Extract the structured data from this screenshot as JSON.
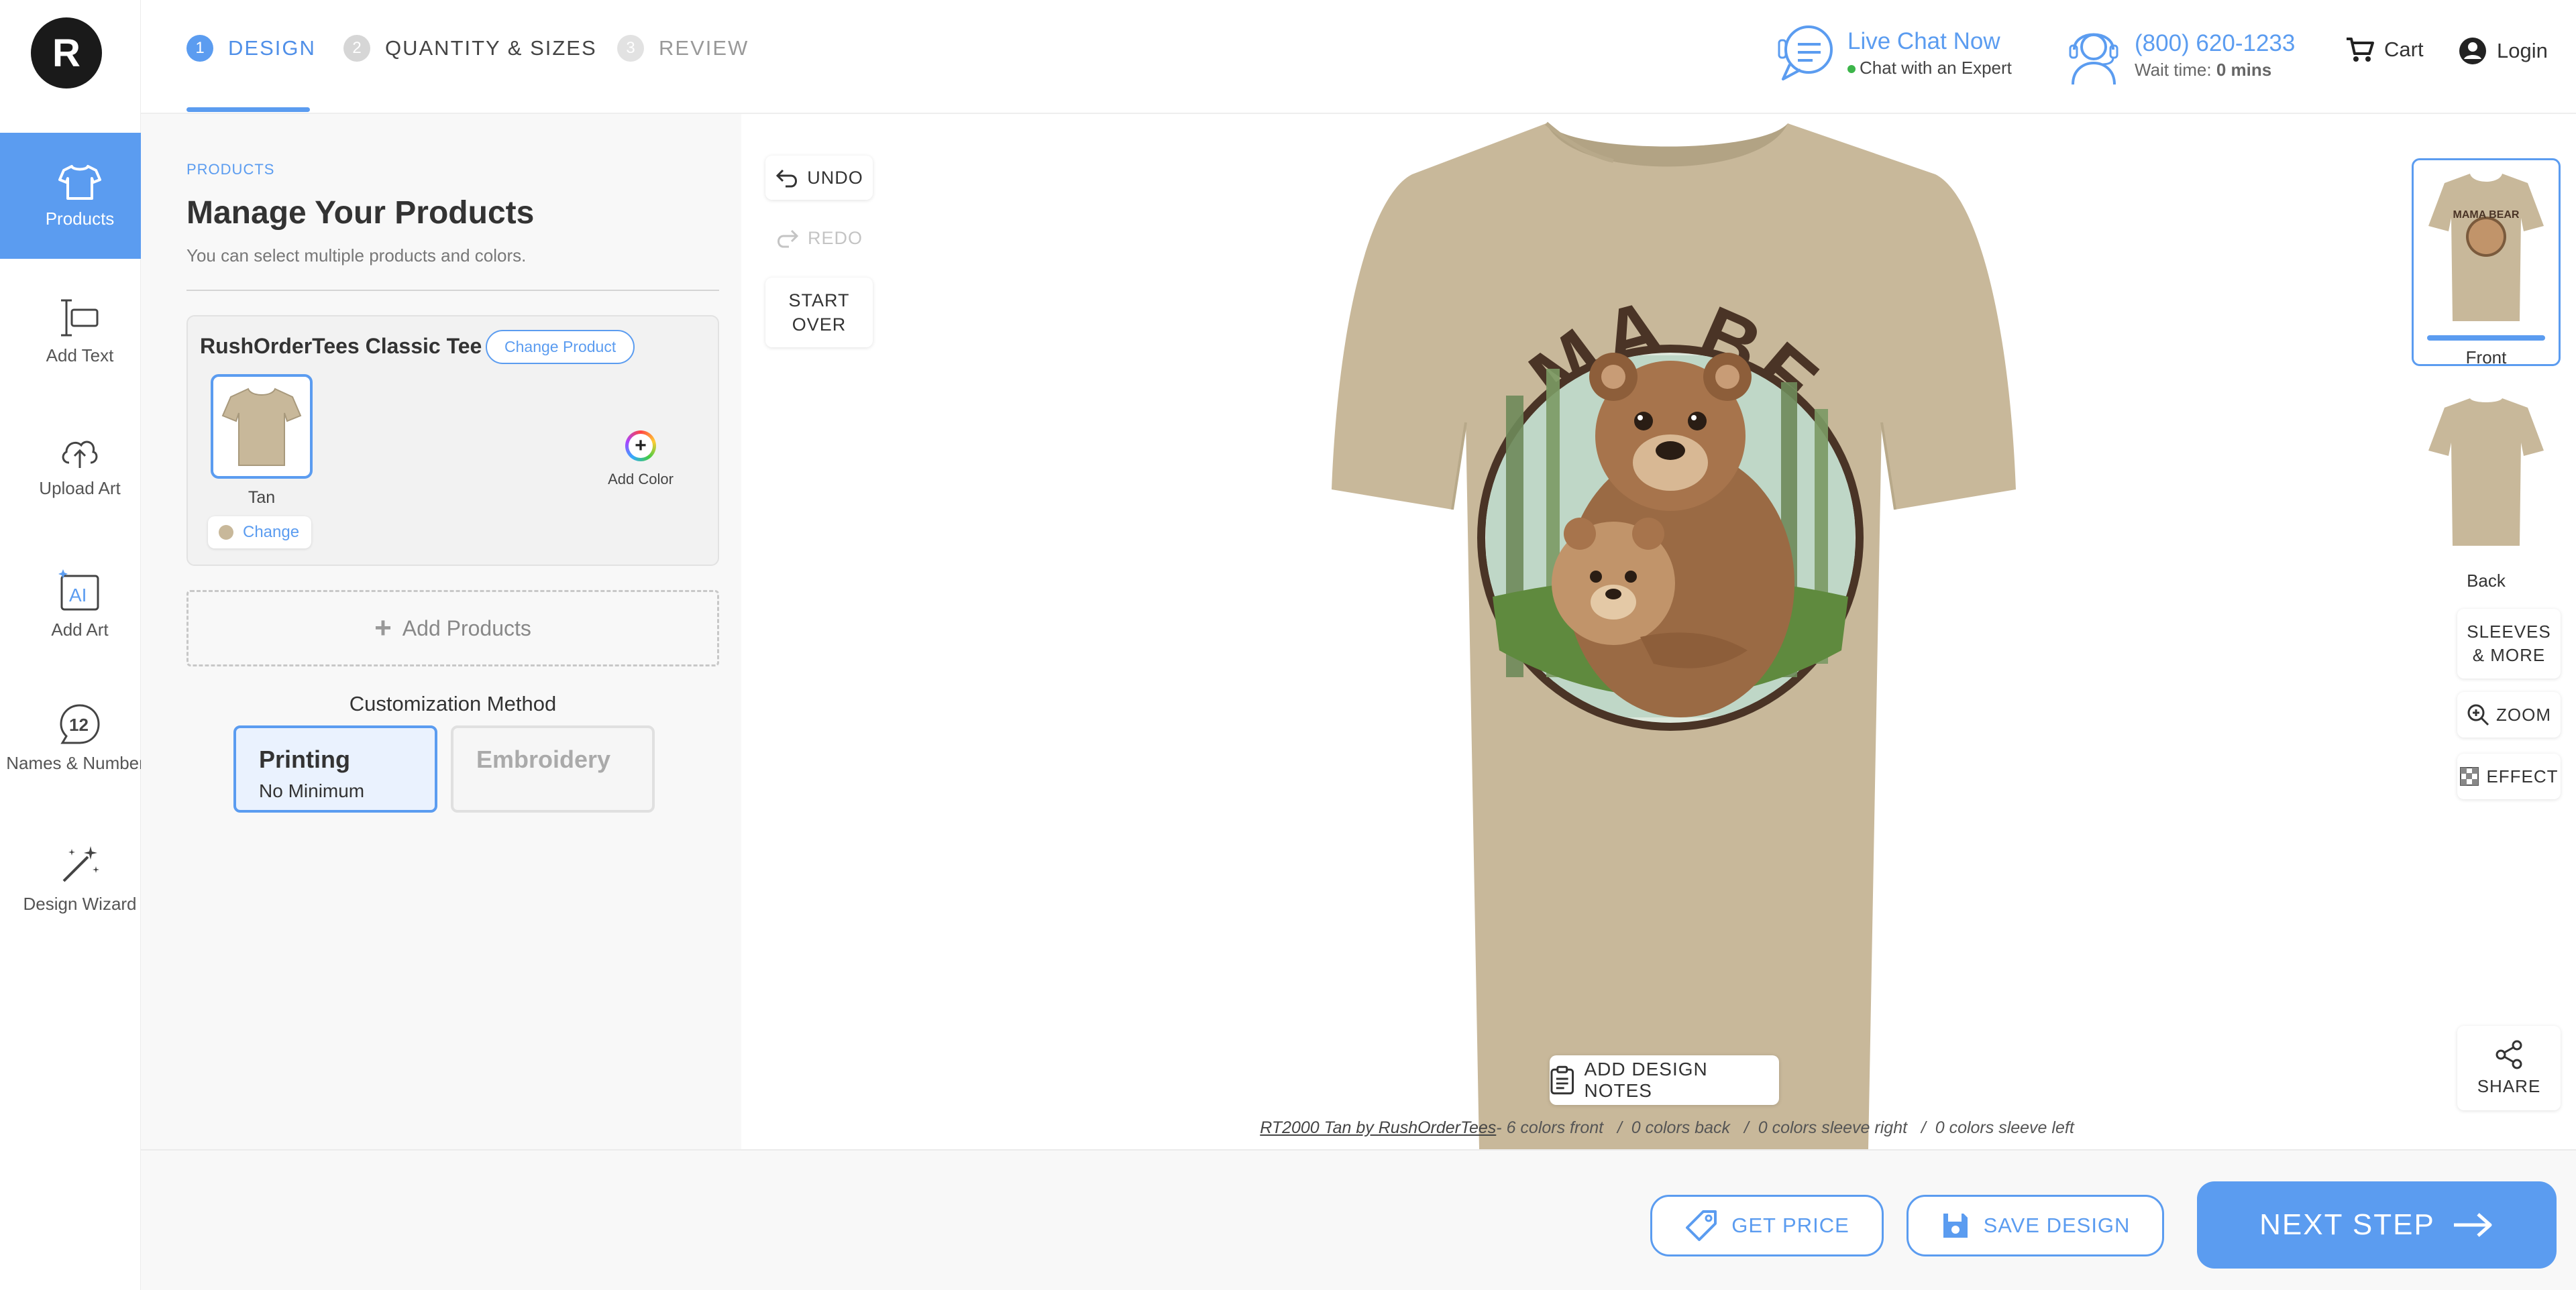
{
  "brand": {
    "logo_letter": "R"
  },
  "rail": {
    "items": [
      {
        "label": "Products",
        "icon": "tshirt-icon"
      },
      {
        "label": "Add Text",
        "icon": "text-icon"
      },
      {
        "label": "Upload Art",
        "icon": "upload-cloud-icon"
      },
      {
        "label": "Add Art",
        "icon": "ai-art-icon"
      },
      {
        "label": "Names & Numbers",
        "icon": "numbers-icon"
      },
      {
        "label": "Design Wizard",
        "icon": "magic-wand-icon"
      }
    ]
  },
  "steps": [
    {
      "num": "1",
      "label": "DESIGN"
    },
    {
      "num": "2",
      "label": "QUANTITY & SIZES"
    },
    {
      "num": "3",
      "label": "REVIEW"
    }
  ],
  "header": {
    "chat_title": "Live Chat Now",
    "chat_sub": "Chat with an Expert",
    "phone": "(800) 620-1233",
    "wait_label": "Wait time:",
    "wait_value": "0 mins",
    "cart": "Cart",
    "login": "Login"
  },
  "panel": {
    "crumb": "PRODUCTS",
    "title": "Manage Your Products",
    "subtitle": "You can select multiple products and colors.",
    "product_name": "RushOrderTees Classic Tee",
    "change_product": "Change Product",
    "color_name": "Tan",
    "change_color": "Change",
    "add_color": "Add Color",
    "add_products": "Add Products",
    "customization_label": "Customization Method",
    "methods": [
      {
        "name": "Printing",
        "note": "No Minimum"
      },
      {
        "name": "Embroidery",
        "note": ""
      }
    ]
  },
  "canvas": {
    "undo": "UNDO",
    "redo": "REDO",
    "start_over_1": "START",
    "start_over_2": "OVER",
    "design_text": "MAMA BEAR",
    "add_notes": "ADD DESIGN NOTES",
    "caption_link": "RT2000 Tan by RushOrderTees",
    "caption_rest": "- 6 colors front   /  0 colors back   /  0 colors sleeve right   /  0 colors sleeve left",
    "views": [
      {
        "label": "Front"
      },
      {
        "label": "Back"
      }
    ],
    "sleeves_1": "SLEEVES",
    "sleeves_2": "& MORE",
    "zoom": "ZOOM",
    "effect": "EFFECT",
    "share": "SHARE"
  },
  "footer": {
    "get_price": "GET PRICE",
    "save_design": "SAVE DESIGN",
    "next_step": "NEXT STEP"
  },
  "colors": {
    "accent": "#5b9cf0",
    "shirt_tan": "#c8b89a"
  }
}
